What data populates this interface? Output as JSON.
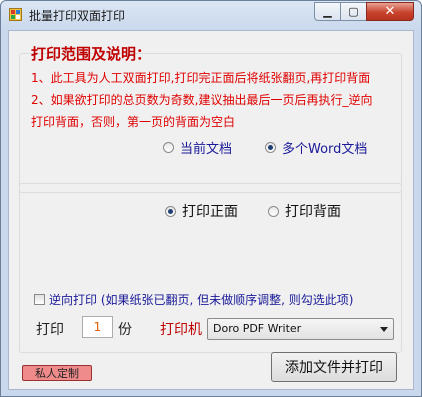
{
  "window": {
    "title": "批量打印双面打印",
    "minimize_glyph": "▁",
    "maximize_glyph": "▢",
    "close_glyph": "✕"
  },
  "instructions": {
    "heading": "打印范围及说明：",
    "line1": "1、此工具为人工双面打印,打印完正面后将纸张翻页,再打印背面",
    "line2": "2、如果欲打印的总页数为奇数,建议抽出最后一页后再执行_逆向",
    "line3": "打印背面，否则，第一页的背面为空白"
  },
  "scope": {
    "options": [
      {
        "label": "当前文档",
        "selected": false
      },
      {
        "label": "多个Word文档",
        "selected": true
      }
    ]
  },
  "side": {
    "options": [
      {
        "label": "打印正面",
        "selected": true
      },
      {
        "label": "打印背面",
        "selected": false
      }
    ]
  },
  "reverse_checkbox": {
    "label": "逆向打印 (如果纸张已翻页, 但未做顺序调整, 则勾选此项)",
    "checked": false
  },
  "copies": {
    "prefix": "打印",
    "value": "1",
    "suffix": "份"
  },
  "printer": {
    "label": "打印机",
    "selected": "Doro PDF Writer"
  },
  "buttons": {
    "add_and_print": "添加文件并打印",
    "private_custom": "私人定制"
  },
  "colors": {
    "instruction_red": "#e00000",
    "heading_red": "#c00000",
    "option_blue": "#1a1a99",
    "private_button": "#f08b8b"
  }
}
